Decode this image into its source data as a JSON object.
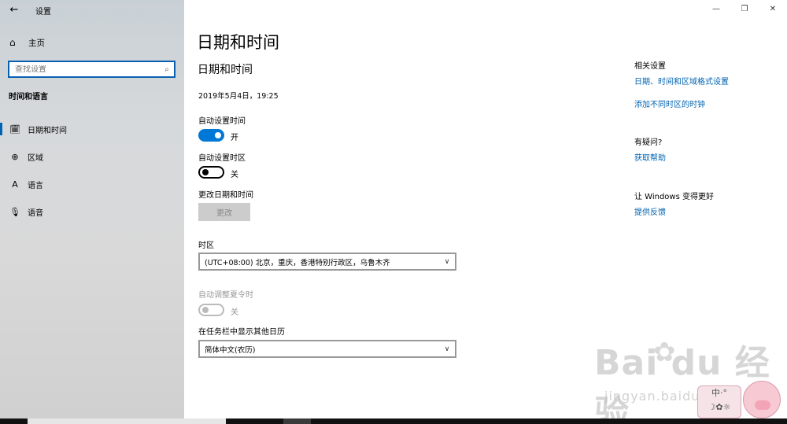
{
  "app": {
    "title": "设置",
    "back_icon": "back-arrow-icon"
  },
  "sidebar": {
    "home_label": "主页",
    "search_placeholder": "查找设置",
    "section_title": "时间和语言",
    "items": [
      {
        "label": "日期和时间",
        "icon": "calendar-clock-icon",
        "selected": true
      },
      {
        "label": "区域",
        "icon": "globe-icon",
        "selected": false
      },
      {
        "label": "语言",
        "icon": "language-icon",
        "selected": false
      },
      {
        "label": "语音",
        "icon": "microphone-icon",
        "selected": false
      }
    ]
  },
  "window_controls": {
    "minimize": "—",
    "restore": "❐",
    "close": "✕"
  },
  "main": {
    "page_title": "日期和时间",
    "sub_title": "日期和时间",
    "current_datetime": "2019年5月4日，19:25",
    "auto_time": {
      "label": "自动设置时间",
      "state_label": "开",
      "on": true
    },
    "auto_timezone": {
      "label": "自动设置时区",
      "state_label": "关",
      "on": false
    },
    "change_datetime": {
      "label": "更改日期和时间",
      "button": "更改",
      "enabled": false
    },
    "timezone": {
      "label": "时区",
      "value": "(UTC+08:00) 北京，重庆，香港特别行政区，乌鲁木齐"
    },
    "dst": {
      "label": "自动调整夏令时",
      "state_label": "关",
      "on": false,
      "enabled": false
    },
    "taskbar_calendar": {
      "label": "在任务栏中显示其他日历",
      "value": "简体中文(农历)"
    }
  },
  "related": {
    "head": "相关设置",
    "links": [
      "日期、时间和区域格式设置",
      "添加不同时区的时钟"
    ],
    "question_head": "有疑问?",
    "help_link": "获取帮助",
    "improve_head": "让 Windows 变得更好",
    "feedback_link": "提供反馈"
  },
  "watermark": {
    "brand": "Bai du 经验",
    "url": "jingyan.baidu.com"
  },
  "colors": {
    "accent": "#0078d7",
    "link": "#0063b1"
  }
}
